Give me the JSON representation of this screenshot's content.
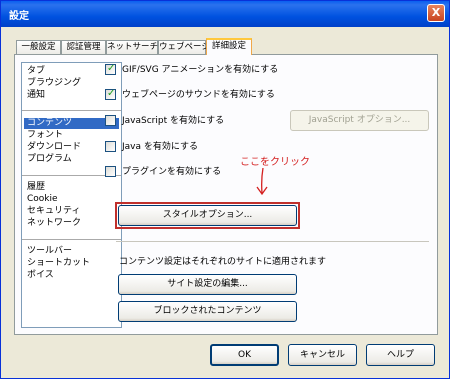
{
  "window": {
    "title": "設定",
    "close": "X"
  },
  "tabs": [
    {
      "label": "一般設定",
      "active": false
    },
    {
      "label": "認証管理",
      "active": false
    },
    {
      "label": "ネットサーチ",
      "active": false
    },
    {
      "label": "ウェブページ",
      "active": false
    },
    {
      "label": "詳細設定",
      "active": true
    }
  ],
  "categories": [
    {
      "label": "タブ"
    },
    {
      "label": "ブラウジング"
    },
    {
      "label": "通知"
    },
    {
      "label": "コンテンツ",
      "selected": true
    },
    {
      "label": "フォント"
    },
    {
      "label": "ダウンロード"
    },
    {
      "label": "プログラム"
    },
    {
      "label": "履歴"
    },
    {
      "label": "Cookie"
    },
    {
      "label": "セキュリティ"
    },
    {
      "label": "ネットワーク"
    },
    {
      "label": "ツールバー"
    },
    {
      "label": "ショートカット"
    },
    {
      "label": "ボイス"
    }
  ],
  "options": [
    {
      "label": "GIF/SVG アニメーションを有効にする",
      "checked": true
    },
    {
      "label": "ウェブページのサウンドを有効にする",
      "checked": true
    },
    {
      "label": "JavaScript を有効にする",
      "checked": false
    },
    {
      "label": "Java を有効にする",
      "checked": false
    },
    {
      "label": "プラグインを有効にする",
      "checked": false
    }
  ],
  "buttons": {
    "javascript_options": "JavaScript オプション...",
    "style_options": "スタイルオプション...",
    "edit_site_prefs": "サイト設定の編集...",
    "blocked_content": "ブロックされたコンテンツ",
    "ok": "OK",
    "cancel": "キャンセル",
    "help": "ヘルプ"
  },
  "info_text": "コンテンツ設定はそれぞれのサイトに適用されます",
  "annotation": {
    "text": "ここをクリック",
    "color": "#d42020"
  },
  "colors": {
    "title_bar": "#0052e0",
    "selection": "#316ac5",
    "check": "#21a121",
    "highlight_box": "#c0302c"
  }
}
